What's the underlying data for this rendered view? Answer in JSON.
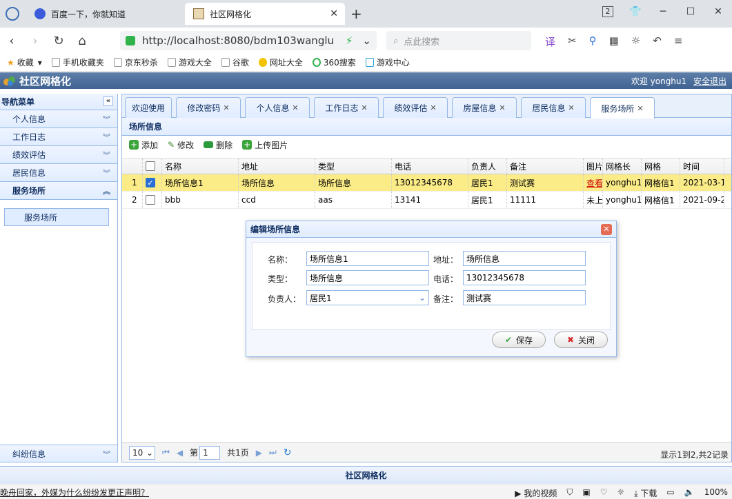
{
  "browser": {
    "tabs": [
      {
        "title": "百度一下，你就知道"
      },
      {
        "title": "社区网格化"
      }
    ],
    "url": "http://localhost:8080/bdm103wanglu",
    "search_placeholder": "点此搜索",
    "window_num": "2",
    "bookmarks": [
      "收藏",
      "手机收藏夹",
      "京东秒杀",
      "游戏大全",
      "谷歌",
      "网址大全",
      "360搜索",
      "游戏中心"
    ]
  },
  "app": {
    "title": "社区网格化",
    "welcome": "欢迎 yonghu1",
    "logout": "安全退出",
    "footer": "社区网格化"
  },
  "sidebar": {
    "header": "导航菜单",
    "items": [
      "个人信息",
      "工作日志",
      "绩效评估",
      "居民信息",
      "服务场所"
    ],
    "sub_item": "服务场所",
    "bottom_item": "纠纷信息"
  },
  "content_tabs": [
    "欢迎使用",
    "修改密码",
    "个人信息",
    "工作日志",
    "绩效评估",
    "房屋信息",
    "居民信息",
    "服务场所"
  ],
  "panel": {
    "title": "场所信息",
    "toolbar": [
      "添加",
      "修改",
      "删除",
      "上传图片"
    ]
  },
  "grid": {
    "columns": [
      "名称",
      "地址",
      "类型",
      "电话",
      "负责人",
      "备注",
      "图片",
      "网格长",
      "网格",
      "时间"
    ],
    "rows": [
      {
        "num": "1",
        "checked": true,
        "cells": [
          "场所信息1",
          "场所信息",
          "场所信息",
          "13012345678",
          "居民1",
          "测试赛",
          "查看",
          "yonghu1",
          "网格信1",
          "2021-03-1"
        ]
      },
      {
        "num": "2",
        "checked": false,
        "cells": [
          "bbb",
          "ccd",
          "aas",
          "13141",
          "居民1",
          "11111",
          "未上",
          "yonghu1",
          "网格信1",
          "2021-09-2"
        ]
      }
    ]
  },
  "pager": {
    "page_size": "10",
    "page_prefix": "第",
    "page": "1",
    "page_suffix": "共1页",
    "info": "显示1到2,共2记录"
  },
  "dialog": {
    "title": "编辑场所信息",
    "fields": {
      "name_label": "名称：",
      "name_value": "场所信息1",
      "addr_label": "地址：",
      "addr_value": "场所信息",
      "type_label": "类型：",
      "type_value": "场所信息",
      "phone_label": "电话：",
      "phone_value": "13012345678",
      "owner_label": "负责人：",
      "owner_value": "居民1",
      "note_label": "备注：",
      "note_value": "测试赛"
    },
    "save": "保存",
    "close": "关闭"
  },
  "statusbar": {
    "news": "晚舟回家，外媒为什么纷纷发更正声明？",
    "video": "我的视频",
    "download": "下载",
    "zoom": "100%"
  }
}
